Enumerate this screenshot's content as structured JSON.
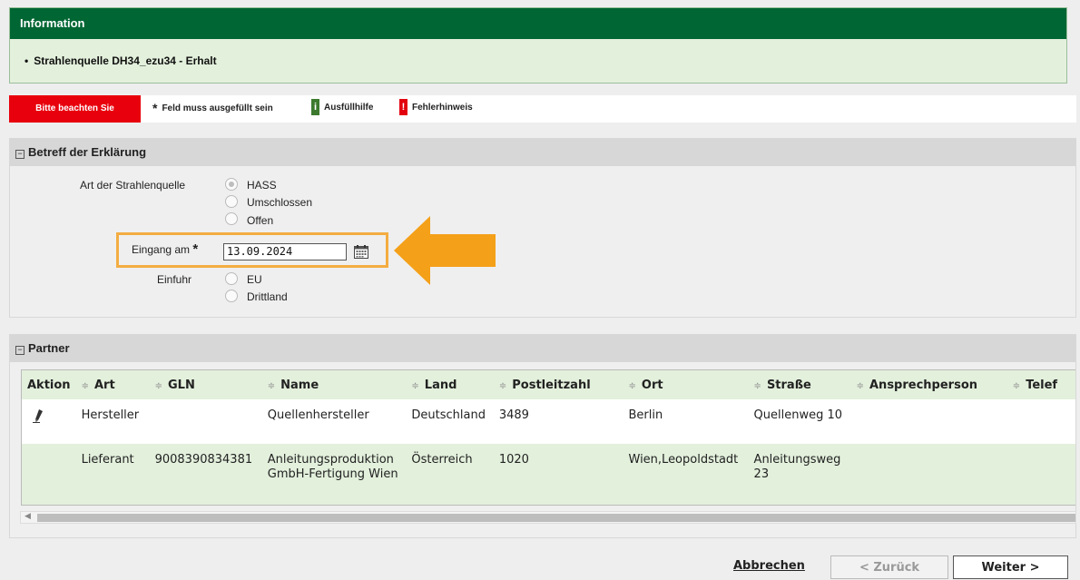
{
  "info": {
    "title": "Information",
    "message": "Strahlenquelle DH34_ezu34 - Erhalt"
  },
  "legend": {
    "note": "Bitte beachten Sie",
    "required_star": "*",
    "required_text": "Feld muss ausgefüllt sein",
    "help_glyph": "i",
    "help_text": "Ausfüllhilfe",
    "error_glyph": "!",
    "error_text": "Fehlerhinweis"
  },
  "betreff": {
    "toggle": "−",
    "title": "Betreff der Erklärung",
    "art_label": "Art der Strahlenquelle",
    "art_options": [
      "HASS",
      "Umschlossen",
      "Offen"
    ],
    "art_selected": "HASS",
    "eingang_label": "Eingang am",
    "eingang_star": "*",
    "eingang_value": "13.09.2024",
    "einfuhr_label": "Einfuhr",
    "einfuhr_options": [
      "EU",
      "Drittland"
    ]
  },
  "partner": {
    "toggle": "−",
    "title": "Partner",
    "columns": [
      "Aktion",
      "Art",
      "GLN",
      "Name",
      "Land",
      "Postleitzahl",
      "Ort",
      "Straße",
      "Ansprechperson",
      "Telef"
    ],
    "sort_glyph": "≑",
    "rows": [
      {
        "aktion_icon": "edit-pen-icon",
        "art": "Hersteller",
        "gln": "",
        "name": "Quellenhersteller",
        "land": "Deutschland",
        "plz": "3489",
        "ort": "Berlin",
        "strasse": "Quellenweg 10",
        "ansprechperson": "",
        "telefon": ""
      },
      {
        "aktion_icon": "",
        "art": "Lieferant",
        "gln": "9008390834381",
        "name": "Anleitungsproduktion GmbH-Fertigung Wien",
        "land": "Österreich",
        "plz": "1020",
        "ort": "Wien,Leopoldstadt",
        "strasse": "Anleitungsweg 23",
        "ansprechperson": "",
        "telefon": ""
      }
    ]
  },
  "buttons": {
    "cancel": "Abbrechen",
    "back": "< Zurück",
    "next": "Weiter >"
  },
  "colors": {
    "header_green": "#006633",
    "panel_green": "#e3f0dc",
    "note_red": "#e8000d",
    "highlight_orange": "#f4ad42"
  }
}
